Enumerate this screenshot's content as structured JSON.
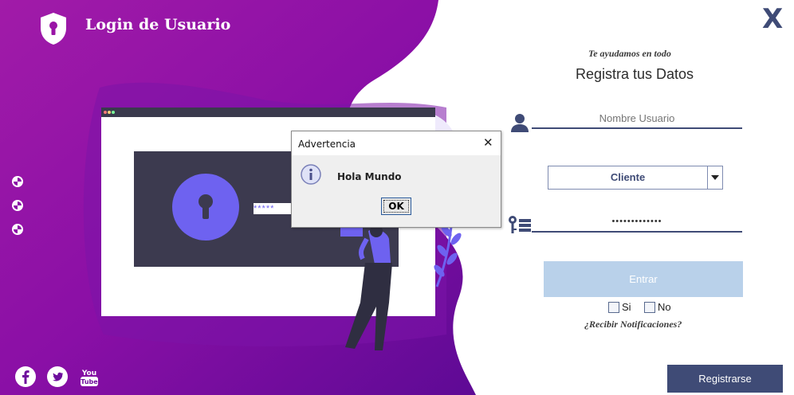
{
  "app": {
    "title": "Login de Usuario"
  },
  "form": {
    "tagline": "Te ayudamos en todo",
    "heading": "Registra tus Datos",
    "username_placeholder": "Nombre Usuario",
    "role_selected": "Cliente",
    "password_value": "•••••••••••••",
    "login_button": "Entrar",
    "options": {
      "yes_label": "Si",
      "no_label": "No"
    },
    "notifications_question": "¿Recibir Notificaciones?",
    "register_button": "Registrarse"
  },
  "close_label": "X",
  "illustration": {
    "password_mask": "*****"
  },
  "dialog": {
    "title": "Advertencia",
    "message": "Hola Mundo",
    "ok_label": "OK",
    "close_glyph": "✕"
  },
  "social": [
    "facebook",
    "twitter",
    "youtube"
  ],
  "colors": {
    "accent": "#3f4b76",
    "purple_dark": "#6d0d9c",
    "purple_light": "#a11ba8",
    "button_disabled": "#b9d1ea",
    "illustration_blue": "#6e62f0"
  }
}
